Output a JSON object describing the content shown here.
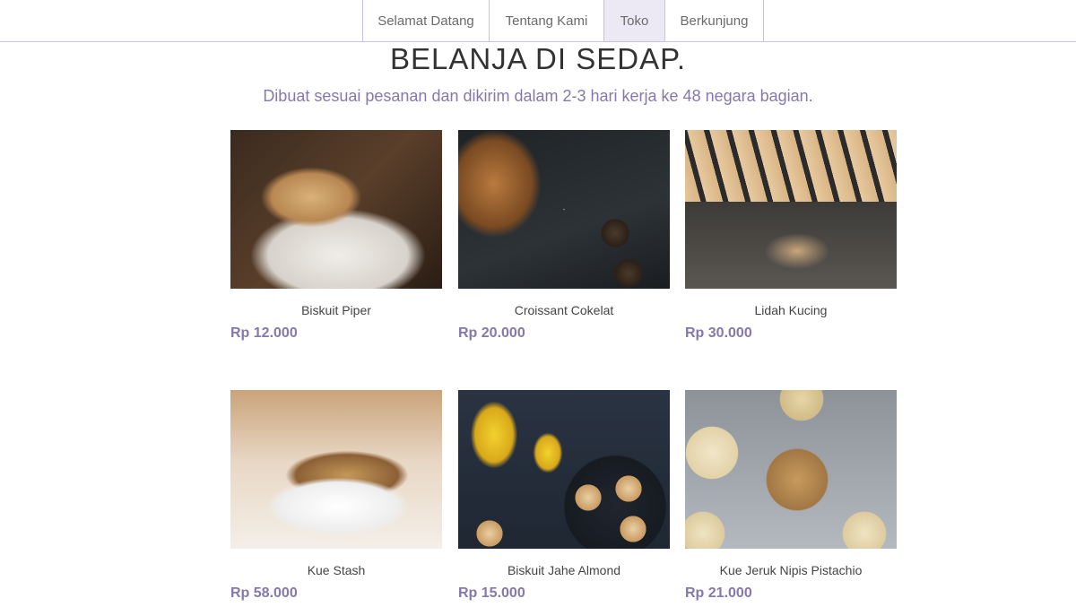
{
  "nav": {
    "items": [
      {
        "label": "Selamat Datang"
      },
      {
        "label": "Tentang Kami"
      },
      {
        "label": "Toko"
      },
      {
        "label": "Berkunjung"
      }
    ],
    "active": "Toko"
  },
  "page": {
    "title": "BELANJA DI SEDAP.",
    "subtitle": "Dibuat sesuai pesanan dan dikirim dalam 2-3 hari kerja ke 48 negara bagian."
  },
  "products": [
    {
      "name": "Biskuit Piper",
      "price": "Rp 12.000"
    },
    {
      "name": "Croissant Cokelat",
      "price": "Rp 20.000"
    },
    {
      "name": "Lidah Kucing",
      "price": "Rp 30.000"
    },
    {
      "name": "Kue Stash",
      "price": "Rp 58.000"
    },
    {
      "name": "Biskuit Jahe Almond",
      "price": "Rp 15.000"
    },
    {
      "name": "Kue Jeruk Nipis Pistachio",
      "price": "Rp 21.000"
    }
  ],
  "colors": {
    "accent": "#8578ad",
    "nav_border": "#c9c3e3",
    "nav_active_bg": "#ece9f5"
  }
}
